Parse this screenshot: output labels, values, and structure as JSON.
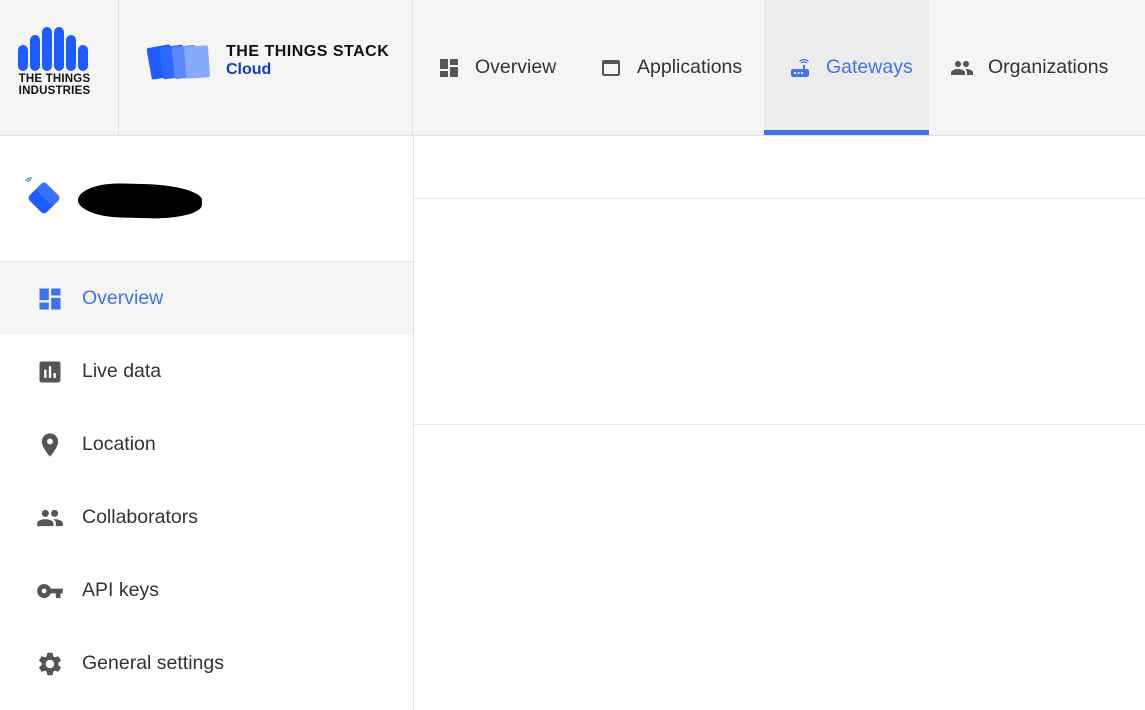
{
  "brand": {
    "company_logo_text_line1": "THE THINGS",
    "company_logo_text_line2": "INDUSTRIES",
    "product_title": "THE THINGS STACK",
    "product_subtitle": "Cloud",
    "accent_color": "#3e73f0",
    "product_subtitle_color": "#0f40b8"
  },
  "nav": {
    "tabs": [
      {
        "label": "Overview",
        "icon": "dashboard-icon",
        "active": false
      },
      {
        "label": "Applications",
        "icon": "application-window-icon",
        "active": false
      },
      {
        "label": "Gateways",
        "icon": "router-icon",
        "active": true
      },
      {
        "label": "Organizations",
        "icon": "people-icon",
        "active": false
      }
    ]
  },
  "sidebar": {
    "gateway": {
      "icon": "gateway-icon",
      "name_redacted": true
    },
    "items": [
      {
        "label": "Overview",
        "icon": "dashboard-icon",
        "active": true
      },
      {
        "label": "Live data",
        "icon": "bar-chart-icon",
        "active": false
      },
      {
        "label": "Location",
        "icon": "location-pin-icon",
        "active": false
      },
      {
        "label": "Collaborators",
        "icon": "people-icon",
        "active": false
      },
      {
        "label": "API keys",
        "icon": "key-icon",
        "active": false
      },
      {
        "label": "General settings",
        "icon": "gear-icon",
        "active": false
      }
    ]
  }
}
